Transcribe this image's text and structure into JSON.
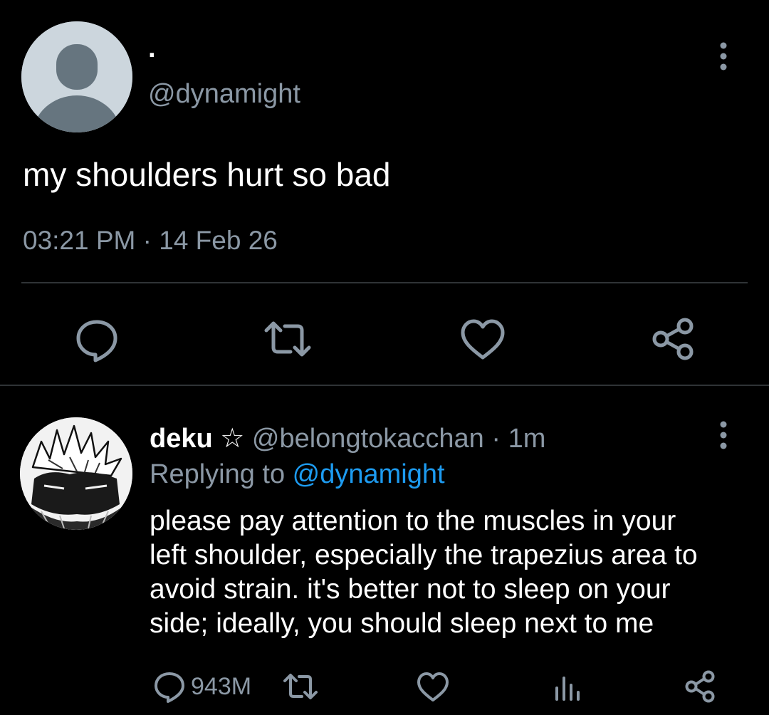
{
  "main_tweet": {
    "display_name": "·",
    "handle": "@dynamight",
    "text": "my shoulders hurt so bad",
    "timestamp": "03:21 PM · 14 Feb 26",
    "actions": [
      "reply-icon",
      "retweet-icon",
      "like-icon",
      "share-icon"
    ]
  },
  "reply": {
    "display_name": "deku ☆",
    "handle": "@belongtokacchan",
    "separator": " · ",
    "time": "1m",
    "replying_prefix": "Replying to ",
    "replying_handle": "@dynamight",
    "text": "please pay attention to the muscles in your\nleft shoulder, especially the trapezius area to\navoid strain. it's better not to sleep on your\nside; ideally, you should sleep next to me",
    "reply_count": "943M",
    "actions": [
      "reply-icon",
      "retweet-icon",
      "like-icon",
      "analytics-icon",
      "share-icon"
    ]
  },
  "colors": {
    "background": "#000000",
    "text": "#ffffff",
    "muted": "#8b98a5",
    "accent": "#1d9bf0",
    "divider": "#2f3336",
    "default_avatar_bg": "#ccd6dd",
    "default_avatar_fg": "#66757f"
  }
}
